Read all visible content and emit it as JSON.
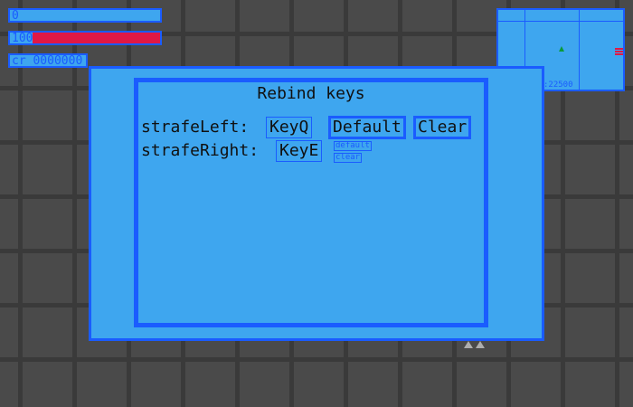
{
  "hud": {
    "shield_value": "0",
    "health_value": "100",
    "health_fraction": 0.85,
    "credits": "cr 0000000"
  },
  "minimap": {
    "coordinate_text": ":22500"
  },
  "dialog": {
    "title": "Rebind keys",
    "bindings": [
      {
        "action": "strafeLeft:",
        "key": "KeyQ",
        "default_label": "Default",
        "clear_label": "Clear"
      },
      {
        "action": "strafeRight:",
        "key": "KeyE",
        "default_label": "default",
        "clear_label": "clear"
      }
    ]
  },
  "colors": {
    "panel_blue": "#3ea6ef",
    "border_blue": "#1a5cff",
    "health_red": "#e01845",
    "background_grey": "#4a4a4a"
  }
}
